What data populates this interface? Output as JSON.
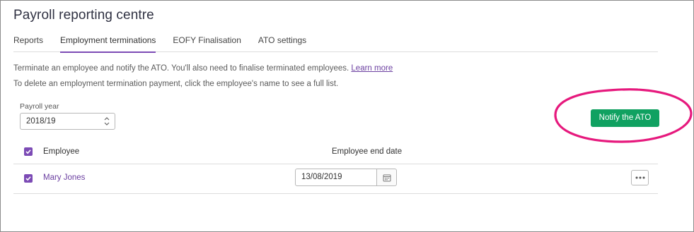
{
  "page": {
    "title": "Payroll reporting centre"
  },
  "tabs": [
    {
      "label": "Reports",
      "active": false
    },
    {
      "label": "Employment terminations",
      "active": true
    },
    {
      "label": "EOFY Finalisation",
      "active": false
    },
    {
      "label": "ATO settings",
      "active": false
    }
  ],
  "info": {
    "line1": "Terminate an employee and notify the ATO. You'll also need to finalise terminated employees.",
    "learn_more": "Learn more",
    "line2": "To delete an employment termination payment, click the employee's name to see a full list."
  },
  "payroll_year": {
    "label": "Payroll year",
    "value": "2018/19"
  },
  "notify_button": {
    "label": "Notify the ATO"
  },
  "table": {
    "headers": {
      "employee": "Employee",
      "end_date": "Employee end date"
    },
    "rows": [
      {
        "employee": "Mary Jones",
        "end_date": "13/08/2019",
        "checked": true
      }
    ]
  },
  "colors": {
    "accent": "#7c4bb5",
    "link": "#6b3fa0",
    "primary_button": "#10a161",
    "annotation": "#e6197d"
  },
  "icons": {
    "select": "up-down-chevron-icon",
    "checkbox": "checkmark-icon",
    "calendar": "calendar-icon",
    "more": "ellipsis-icon"
  }
}
